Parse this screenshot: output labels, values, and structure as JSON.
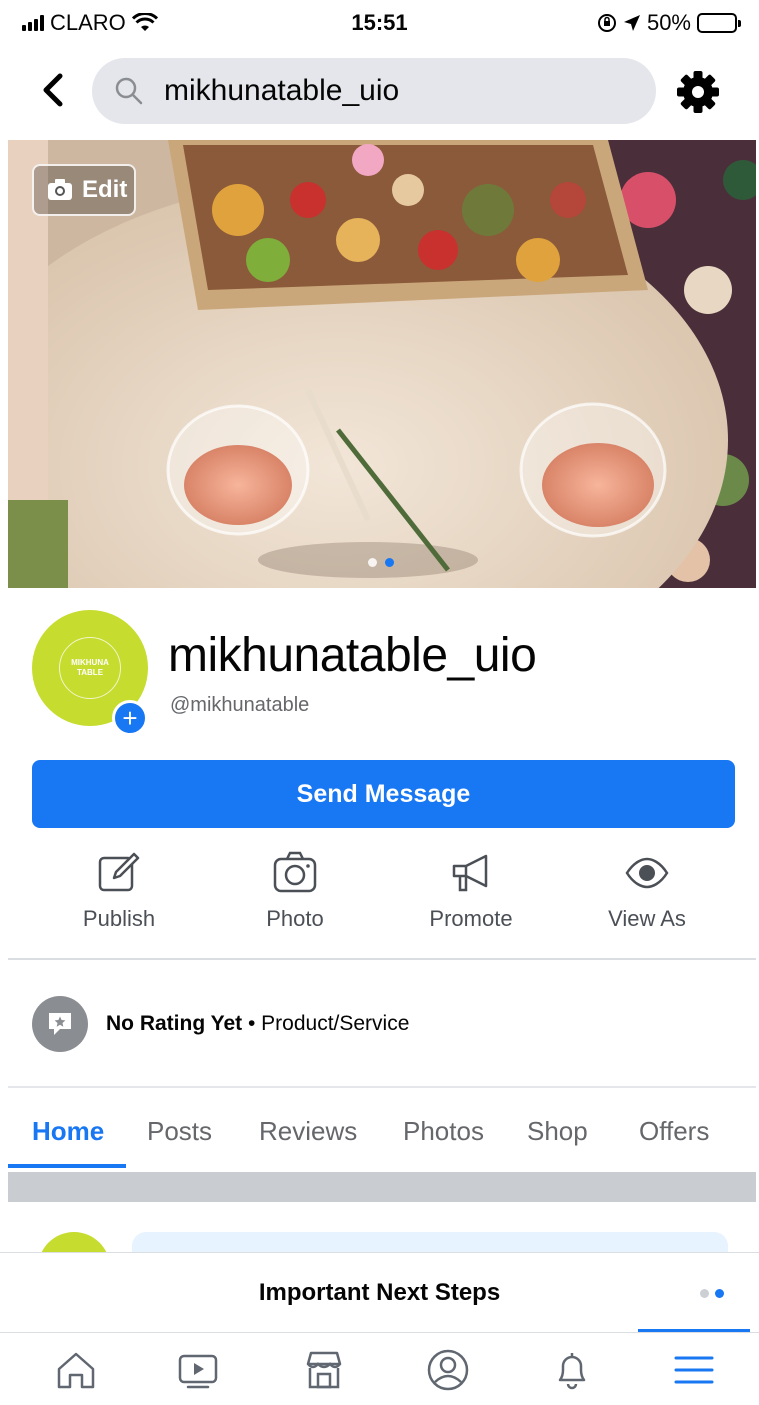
{
  "status_bar": {
    "carrier": "CLARO",
    "time": "15:51",
    "battery": "50%",
    "battery_level": 0.5
  },
  "header": {
    "search_text": "mikhunatable_uio"
  },
  "cover": {
    "edit_label": "Edit",
    "slide_count": 2,
    "active_slide": 2
  },
  "profile": {
    "avatar_text_line1": "MIKHUNA",
    "avatar_text_line2": "TABLE",
    "name": "mikhunatable_uio",
    "handle": "@mikhunatable"
  },
  "send_message_label": "Send Message",
  "actions": [
    {
      "label": "Publish",
      "icon": "compose-icon"
    },
    {
      "label": "Photo",
      "icon": "camera-icon"
    },
    {
      "label": "Promote",
      "icon": "megaphone-icon"
    },
    {
      "label": "View As",
      "icon": "eye-icon"
    }
  ],
  "rating": {
    "bold": "No Rating Yet",
    "rest": " • Product/Service"
  },
  "tabs": [
    "Home",
    "Posts",
    "Reviews",
    "Photos",
    "Shop",
    "Offers"
  ],
  "active_tab": "Home",
  "next_steps": {
    "title": "Important Next Steps"
  },
  "bottom_nav": [
    "home-icon",
    "video-icon",
    "marketplace-icon",
    "profile-icon",
    "bell-icon",
    "menu-icon"
  ],
  "colors": {
    "accent": "#1877f2",
    "avatar_green": "#c6dc2e"
  }
}
